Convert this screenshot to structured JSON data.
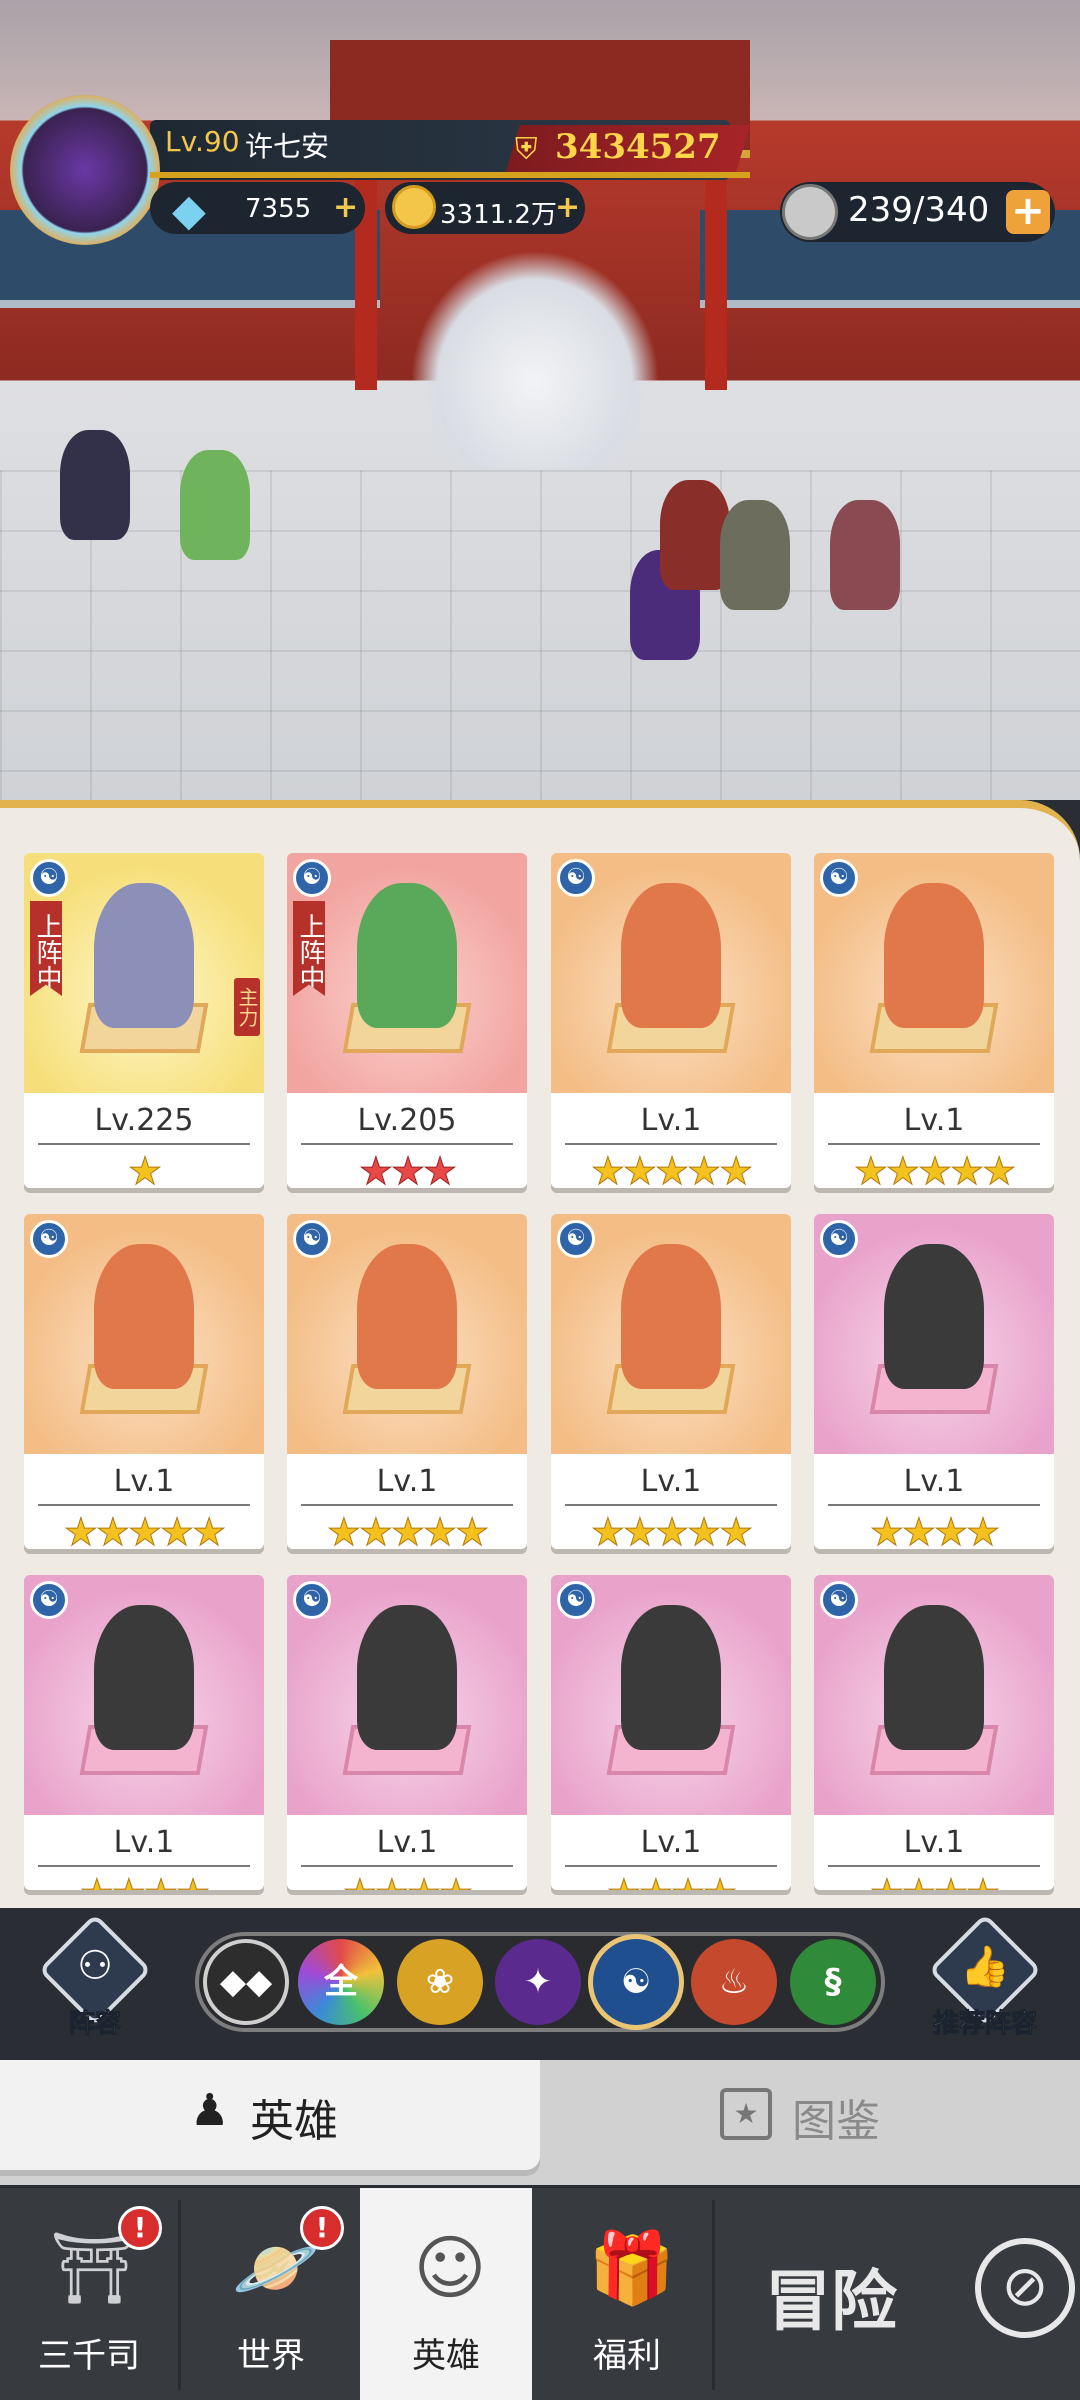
{
  "player": {
    "level": "Lv.90",
    "name": "许七安",
    "power": "3434527"
  },
  "currency": {
    "diamonds": "7355",
    "gold": "3311.2万",
    "plus": "+"
  },
  "stamina": {
    "value": "239/340",
    "plus": "+"
  },
  "heroes": [
    {
      "level": "Lv.225",
      "stars": "★",
      "bg": "yellow",
      "tag": "上阵中",
      "main": "主力"
    },
    {
      "level": "Lv.205",
      "stars": "★★★",
      "bg": "red",
      "tag": "上阵中",
      "star_color": "red"
    },
    {
      "level": "Lv.1",
      "stars": "★★★★★",
      "bg": "orange"
    },
    {
      "level": "Lv.1",
      "stars": "★★★★★",
      "bg": "orange"
    },
    {
      "level": "Lv.1",
      "stars": "★★★★★",
      "bg": "orange"
    },
    {
      "level": "Lv.1",
      "stars": "★★★★★",
      "bg": "orange"
    },
    {
      "level": "Lv.1",
      "stars": "★★★★★",
      "bg": "orange"
    },
    {
      "level": "Lv.1",
      "stars": "★★★★",
      "bg": "pink"
    },
    {
      "level": "Lv.1",
      "stars": "★★★★",
      "bg": "pink"
    },
    {
      "level": "Lv.1",
      "stars": "★★★★",
      "bg": "pink"
    },
    {
      "level": "Lv.1",
      "stars": "★★★★",
      "bg": "pink"
    },
    {
      "level": "Lv.1",
      "stars": "★★★★",
      "bg": "pink"
    }
  ],
  "side": {
    "formation": "阵容",
    "recommend": "推荐阵容"
  },
  "filters": {
    "all": "全"
  },
  "tabs": {
    "heroes": "英雄",
    "codex": "图鉴"
  },
  "nav": [
    {
      "label": "三千司",
      "badge": "!"
    },
    {
      "label": "世界",
      "badge": "!"
    },
    {
      "label": "英雄"
    },
    {
      "label": "福利"
    },
    {
      "label": "冒险"
    }
  ]
}
